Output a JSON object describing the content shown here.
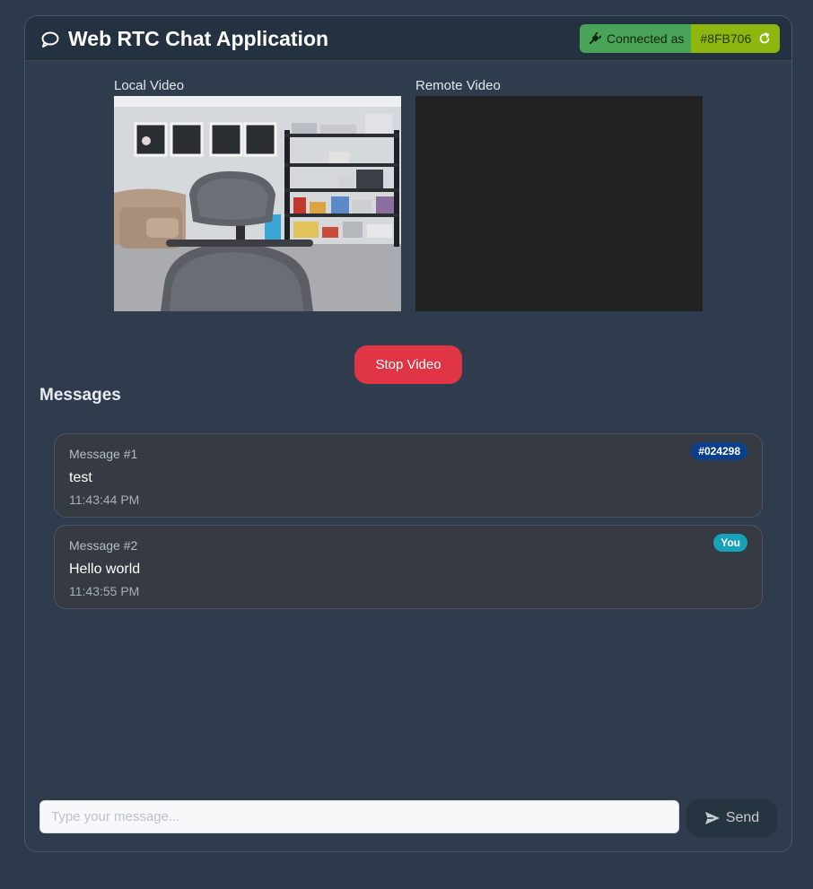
{
  "app": {
    "title": "Web RTC Chat Application"
  },
  "connection": {
    "status_label": "Connected as",
    "user_id": "#8FB706"
  },
  "video": {
    "local_label": "Local Video",
    "remote_label": "Remote Video",
    "stop_button": "Stop Video"
  },
  "messages": {
    "heading": "Messages",
    "items": [
      {
        "label": "Message #1",
        "text": "test",
        "time": "11:43:44 PM",
        "sender": "#024298",
        "sender_color": "#0a3f8c"
      },
      {
        "label": "Message #2",
        "text": "Hello world",
        "time": "11:43:55 PM",
        "sender": "You",
        "sender_color": "#17a2b8"
      }
    ]
  },
  "composer": {
    "placeholder": "Type your message...",
    "send_label": "Send"
  },
  "colors": {
    "background": "#2c3a4b",
    "connected_green": "#4aa457",
    "user_id_green": "#8db70f",
    "stop_red": "#e03545"
  }
}
